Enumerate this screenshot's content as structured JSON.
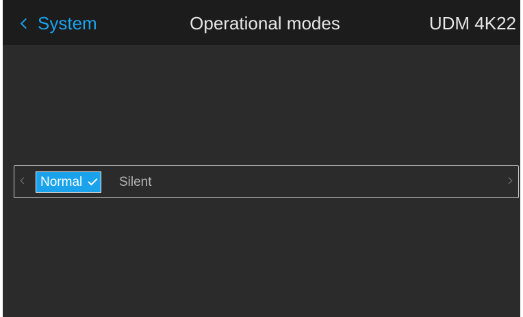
{
  "header": {
    "back_label": "System",
    "title": "Operational modes",
    "device": "UDM 4K22"
  },
  "mode_selector": {
    "options": [
      {
        "label": "Normal",
        "selected": true
      },
      {
        "label": "Silent",
        "selected": false
      }
    ]
  },
  "colors": {
    "accent": "#1aa3ec",
    "header_bg": "#1c1c1c",
    "screen_bg": "#2b2b2b",
    "text": "#e6e6e6",
    "inactive_text": "#b4b4b4"
  },
  "icons": {
    "back": "chevron-left-icon",
    "prev": "chevron-left-icon",
    "next": "chevron-right-icon",
    "selected": "check-icon"
  }
}
